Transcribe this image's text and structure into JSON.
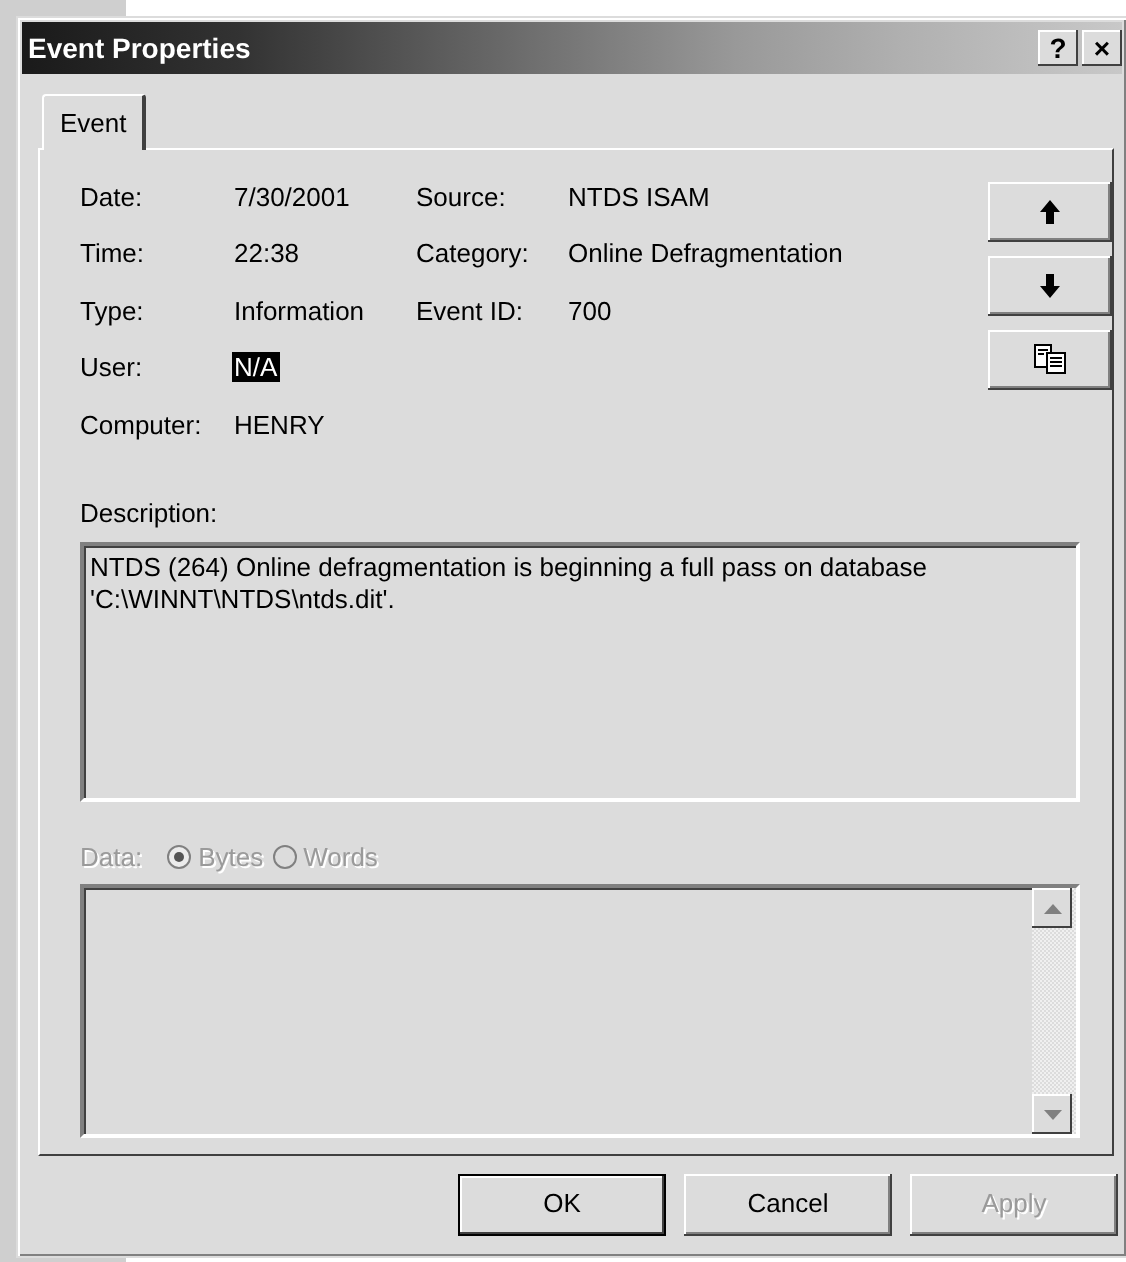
{
  "window": {
    "title": "Event Properties",
    "title_buttons": [
      "?",
      "×"
    ]
  },
  "tabs": [
    {
      "label": "Event",
      "selected": true
    }
  ],
  "details": {
    "left": [
      {
        "label": "Date:",
        "value": "7/30/2001",
        "selected": false
      },
      {
        "label": "Time:",
        "value": "22:38",
        "selected": false
      },
      {
        "label": "Type:",
        "value": "Information",
        "selected": false
      },
      {
        "label": "User:",
        "value": "N/A",
        "selected": true
      },
      {
        "label": "Computer:",
        "value": "HENRY",
        "selected": false
      }
    ],
    "right": [
      {
        "label": "Source:",
        "value": "NTDS ISAM",
        "selected": false
      },
      {
        "label": "Category:",
        "value": "Online Defragmentation",
        "selected": false
      },
      {
        "label": "Event ID:",
        "value": "700",
        "selected": false
      }
    ]
  },
  "side_buttons": [
    {
      "kind": "up"
    },
    {
      "kind": "down"
    },
    {
      "kind": "copy"
    }
  ],
  "description": {
    "label": "Description:",
    "text": "NTDS (264) Online defragmentation is beginning a full pass on database 'C:\\WINNT\\NTDS\\ntds.dit'."
  },
  "data": {
    "label": "Data:",
    "disabled": true,
    "options": [
      {
        "label": "Bytes",
        "selected": true
      },
      {
        "label": "Words",
        "selected": false
      }
    ]
  },
  "buttons": [
    {
      "label": "OK",
      "default": true,
      "disabled": false
    },
    {
      "label": "Cancel",
      "default": false,
      "disabled": false
    },
    {
      "label": "Apply",
      "default": false,
      "disabled": true
    }
  ]
}
